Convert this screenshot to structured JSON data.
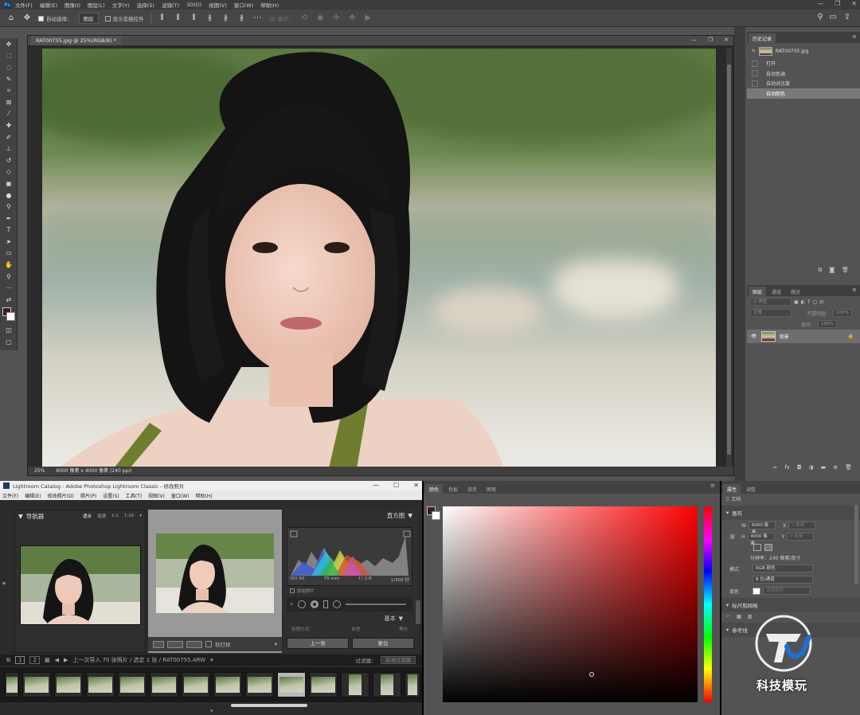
{
  "ps": {
    "menu": [
      "文件(F)",
      "编辑(E)",
      "图像(I)",
      "图层(L)",
      "文字(Y)",
      "选择(S)",
      "滤镜(T)",
      "3D(D)",
      "视图(V)",
      "窗口(W)",
      "帮助(H)"
    ],
    "options": {
      "auto_select_label": "自动选择：",
      "auto_select_value": "图层",
      "show_transform_label": "显示变换控件",
      "mode_3d_label": "3D 模式："
    },
    "document": {
      "tab_title": "RAT00755.jpg @ 25%(RGB/8) *",
      "zoom": "25%",
      "doc_size": "6000 像素 x 4000 像素 (240 ppi)"
    },
    "history": {
      "tab": "历史记录",
      "snapshot": "RAT00755.jpg",
      "items": [
        "打开",
        "自动色调",
        "自动对比度",
        "自动颜色"
      ]
    },
    "layers": {
      "tabs": [
        "图层",
        "通道",
        "路径"
      ],
      "search_placeholder": "Q 类型",
      "blend_mode": "正常",
      "opacity_label": "不透明度：",
      "opacity_value": "100%",
      "fill_label": "填充：",
      "fill_value": "100%",
      "layer_name": "背景"
    }
  },
  "lr": {
    "title": "Lightroom Catalog - Adobe Photoshop Lightroom Classic - 修改照片",
    "menu": [
      "文件(F)",
      "编辑(E)",
      "修改照片(D)",
      "照片(P)",
      "设置(S)",
      "工具(T)",
      "视图(V)",
      "窗口(W)",
      "帮助(H)"
    ],
    "navigator": {
      "label": "导航器",
      "zoom_options": [
        "适合",
        "填满",
        "1:1",
        "1:16"
      ]
    },
    "histogram": {
      "label": "直方图",
      "exif": [
        "ISO 50",
        "75 mm",
        "f / 2.8",
        "1/500 秒"
      ],
      "original_photo": "原始照片"
    },
    "basic_label": "基本",
    "basic_sub": [
      "处理方式：",
      "彩色",
      "黑白"
    ],
    "buttons": {
      "previous": "上一张",
      "reset": "复位"
    },
    "toolbar_softproof": "软打样",
    "filmstrip": {
      "pages": [
        "1",
        "2"
      ],
      "info": "上一次导入   70 张照片 / 选定 1 张 / RAT00755.ARW",
      "filter_label": "过滤器：",
      "filter_value": "关闭过滤器"
    }
  },
  "color_picker": {
    "tabs": [
      "颜色",
      "色板",
      "渐变",
      "图案"
    ]
  },
  "properties": {
    "tabs": [
      "属性",
      "调整"
    ],
    "doc_label": "文档",
    "canvas_label": "画布",
    "width_label": "W",
    "width_value": "6000 像素",
    "height_label": "H",
    "height_value": "4000 像素",
    "x_label": "X",
    "x_value": "0 像素",
    "y_label": "Y",
    "y_value": "0 像素",
    "resolution": "分辨率：240 像素/英寸",
    "mode_label": "模式",
    "mode_value": "RGB 颜色",
    "depth_value": "8 位/通道",
    "fill_label": "填色",
    "fill_value": "背景颜色",
    "rulers_label": "标尺和网格",
    "guides_label": "参考线"
  },
  "watermark": "科技模玩",
  "colors": {
    "ps_bg": "#535353",
    "foreground_swatch": "#3d1e1e",
    "lr_bg": "#2b2b2b"
  }
}
